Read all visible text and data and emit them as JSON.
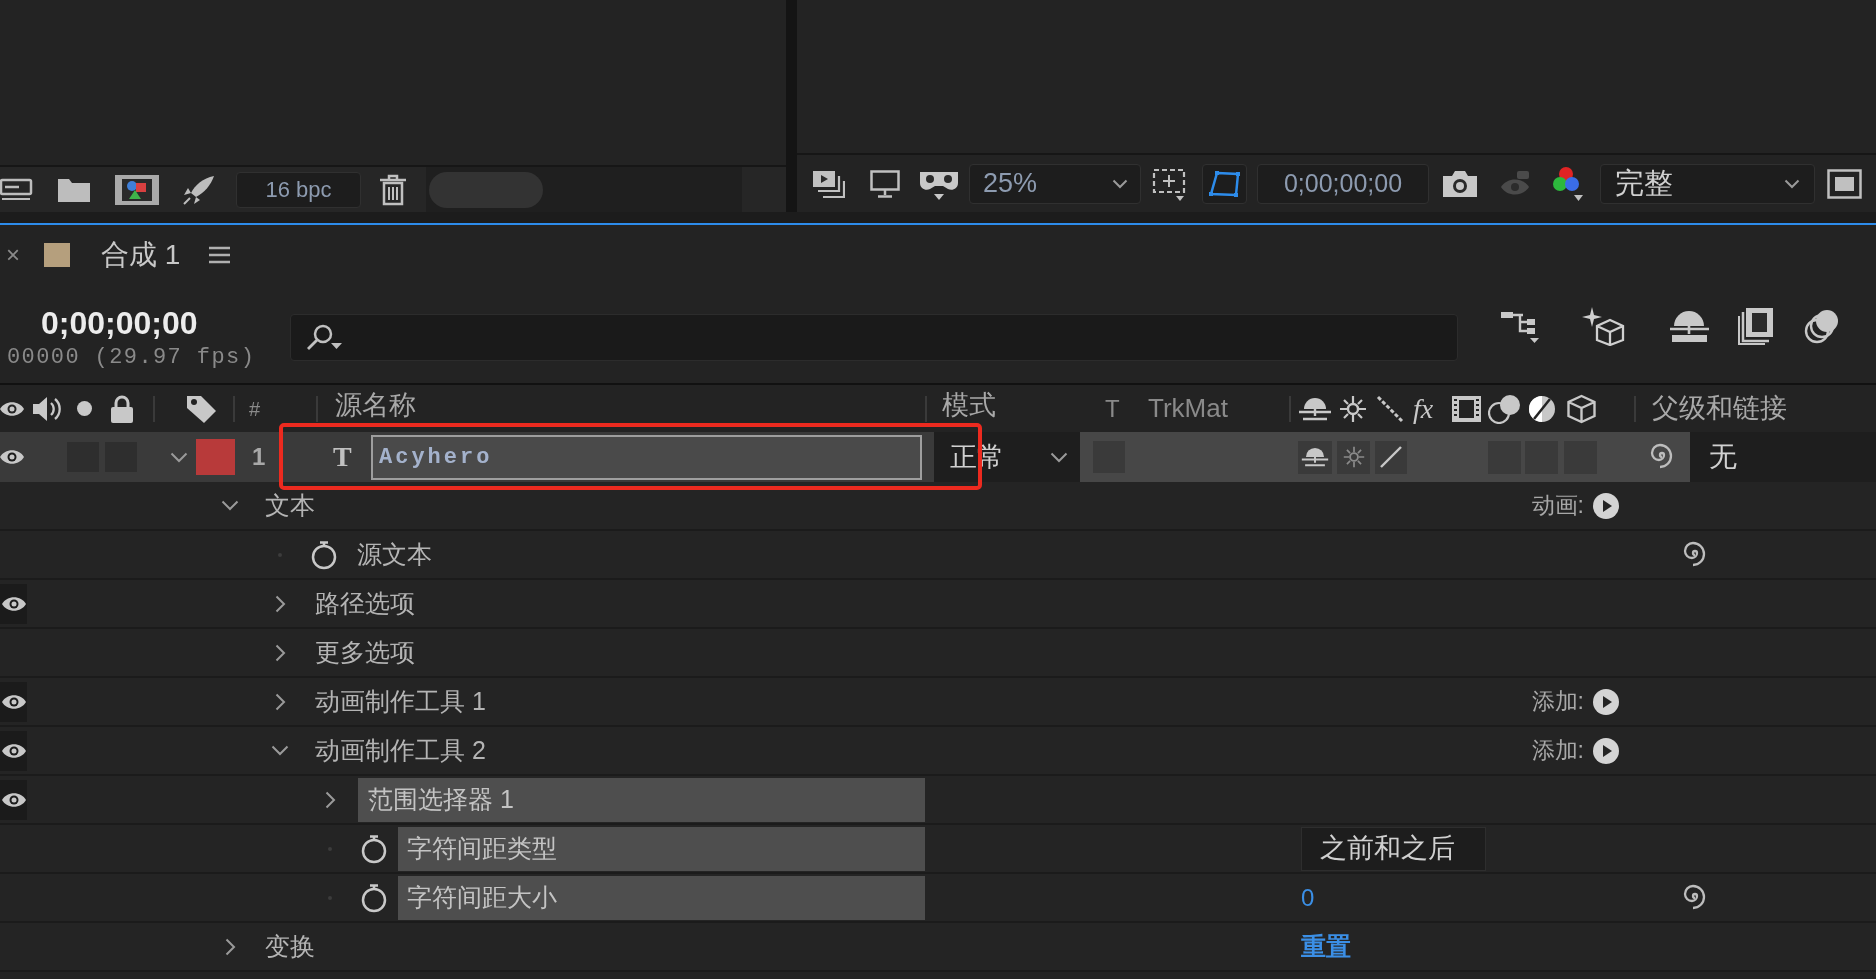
{
  "project_panel": {
    "bit_depth": "16 bpc"
  },
  "viewer": {
    "zoom": "25%",
    "mask_visibility": true,
    "timecode": "0;00;00;00",
    "resolution": "完整"
  },
  "timeline": {
    "tab": {
      "close": "×",
      "title": "合成 1"
    },
    "timecode": "0;00;00;00",
    "frame_info": "00000 (29.97 fps)",
    "columns": {
      "number": "#",
      "source_name": "源名称",
      "mode": "模式",
      "preserve_transparency": "T",
      "track_matte": "TrkMat",
      "effects": "fx",
      "parent": "父级和链接"
    },
    "layers": [
      {
        "number": "1",
        "type_glyph": "T",
        "name": "Acyhero",
        "editing": true,
        "color": "#b83a3a",
        "visible": true,
        "solo": false,
        "locked": false,
        "expanded": true,
        "mode": "正常",
        "shy": false,
        "collapse_transformations": false,
        "best_quality": true,
        "parent": "无"
      }
    ],
    "properties": [
      {
        "kind": "group",
        "name": "文本",
        "expanded": true,
        "selected": false,
        "visible": false,
        "pickwhip": false,
        "action": "动画:",
        "children": [
          {
            "kind": "property",
            "name": "源文本",
            "selected": false,
            "visible": false,
            "pickwhip": true
          },
          {
            "kind": "group",
            "name": "路径选项",
            "expanded": false,
            "selected": false,
            "visible": true,
            "pickwhip": false
          },
          {
            "kind": "group",
            "name": "更多选项",
            "expanded": false,
            "selected": false,
            "visible": false,
            "pickwhip": false
          },
          {
            "kind": "group",
            "name": "动画制作工具 1",
            "expanded": false,
            "selected": false,
            "visible": true,
            "pickwhip": false,
            "action": "添加:"
          },
          {
            "kind": "group",
            "name": "动画制作工具 2",
            "expanded": true,
            "selected": false,
            "visible": true,
            "pickwhip": false,
            "action": "添加:",
            "children": [
              {
                "kind": "group",
                "name": "范围选择器 1",
                "expanded": false,
                "selected": true,
                "visible": true,
                "pickwhip": false
              },
              {
                "kind": "property",
                "name": "字符间距类型",
                "selected": true,
                "visible": false,
                "pickwhip": false,
                "value": {
                  "kind": "dropdown",
                  "text": "之前和之后"
                }
              },
              {
                "kind": "property",
                "name": "字符间距大小",
                "selected": true,
                "visible": false,
                "pickwhip": true,
                "value": {
                  "kind": "number",
                  "text": "0"
                }
              }
            ]
          }
        ]
      },
      {
        "kind": "group",
        "name": "变换",
        "expanded": false,
        "selected": false,
        "visible": false,
        "pickwhip": false,
        "value": {
          "kind": "link",
          "text": "重置"
        }
      }
    ]
  }
}
